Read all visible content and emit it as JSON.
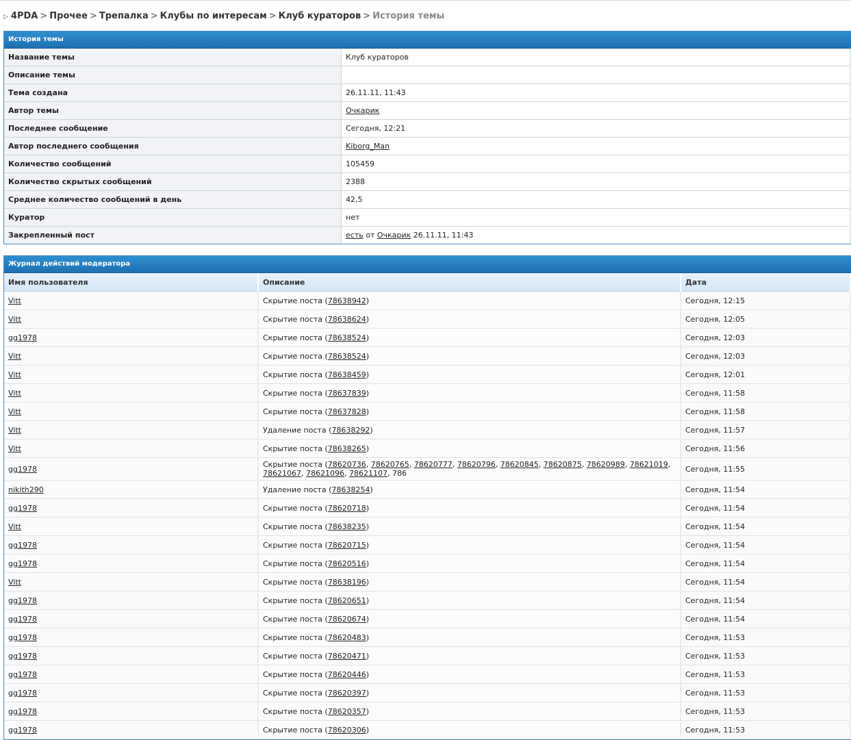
{
  "breadcrumb": {
    "items": [
      "4PDA",
      "Прочее",
      "Трепалка",
      "Клубы по интересам",
      "Клуб кураторов"
    ],
    "current": "История темы",
    "separator": ">",
    "arrow": "▷"
  },
  "history": {
    "title": "История темы",
    "rows": [
      {
        "label": "Название темы",
        "value": "Клуб кураторов"
      },
      {
        "label": "Описание темы",
        "value": ""
      },
      {
        "label": "Тема создана",
        "value": "26.11.11, 11:43"
      },
      {
        "label": "Автор темы",
        "value": "Очкарик",
        "link": true
      },
      {
        "label": "Последнее сообщение",
        "value": "Сегодня, 12:21"
      },
      {
        "label": "Автор последнего сообщения",
        "value": "Kiborg_Man",
        "link": true
      },
      {
        "label": "Количество сообщений",
        "value": "105459"
      },
      {
        "label": "Количество скрытых сообщений",
        "value": "2388"
      },
      {
        "label": "Среднее количество сообщений в день",
        "value": "42,5"
      },
      {
        "label": "Куратор",
        "value": "нет"
      }
    ],
    "pinned": {
      "label": "Закрепленный пост",
      "link1": "есть",
      "from": "от",
      "link2": "Очкарик",
      "date": "26.11.11, 11:43"
    }
  },
  "log": {
    "title": "Журнал действий модератора",
    "columns": [
      "Имя пользователя",
      "Описание",
      "Дата"
    ],
    "rows": [
      {
        "user": "Vitt",
        "action": "Скрытие поста",
        "posts": [
          "78638942"
        ],
        "date": "Сегодня, 12:15"
      },
      {
        "user": "Vitt",
        "action": "Скрытие поста",
        "posts": [
          "78638624"
        ],
        "date": "Сегодня, 12:05"
      },
      {
        "user": "gg1978",
        "action": "Скрытие поста",
        "posts": [
          "78638524"
        ],
        "date": "Сегодня, 12:03"
      },
      {
        "user": "Vitt",
        "action": "Скрытие поста",
        "posts": [
          "78638524"
        ],
        "date": "Сегодня, 12:03"
      },
      {
        "user": "Vitt",
        "action": "Скрытие поста",
        "posts": [
          "78638459"
        ],
        "date": "Сегодня, 12:01"
      },
      {
        "user": "Vitt",
        "action": "Скрытие поста",
        "posts": [
          "78637839"
        ],
        "date": "Сегодня, 11:58"
      },
      {
        "user": "Vitt",
        "action": "Скрытие поста",
        "posts": [
          "78637828"
        ],
        "date": "Сегодня, 11:58"
      },
      {
        "user": "Vitt",
        "action": "Удаление поста",
        "posts": [
          "78638292"
        ],
        "date": "Сегодня, 11:57"
      },
      {
        "user": "Vitt",
        "action": "Скрытие поста",
        "posts": [
          "78638265"
        ],
        "date": "Сегодня, 11:56"
      },
      {
        "user": "gg1978",
        "action": "Скрытие поста",
        "posts": [
          "78620736",
          "78620765",
          "78620777",
          "78620796",
          "78620845",
          "78620875",
          "78620989",
          "78621019",
          "78621067",
          "78621096",
          "78621107"
        ],
        "tail": "786",
        "date": "Сегодня, 11:55"
      },
      {
        "user": "nikith290",
        "action": "Удаление поста",
        "posts": [
          "78638254"
        ],
        "date": "Сегодня, 11:54"
      },
      {
        "user": "gg1978",
        "action": "Скрытие поста",
        "posts": [
          "78620718"
        ],
        "date": "Сегодня, 11:54"
      },
      {
        "user": "Vitt",
        "action": "Скрытие поста",
        "posts": [
          "78638235"
        ],
        "date": "Сегодня, 11:54"
      },
      {
        "user": "gg1978",
        "action": "Скрытие поста",
        "posts": [
          "78620715"
        ],
        "date": "Сегодня, 11:54"
      },
      {
        "user": "gg1978",
        "action": "Скрытие поста",
        "posts": [
          "78620516"
        ],
        "date": "Сегодня, 11:54"
      },
      {
        "user": "Vitt",
        "action": "Скрытие поста",
        "posts": [
          "78638196"
        ],
        "date": "Сегодня, 11:54"
      },
      {
        "user": "gg1978",
        "action": "Скрытие поста",
        "posts": [
          "78620651"
        ],
        "date": "Сегодня, 11:54"
      },
      {
        "user": "gg1978",
        "action": "Скрытие поста",
        "posts": [
          "78620674"
        ],
        "date": "Сегодня, 11:54"
      },
      {
        "user": "gg1978",
        "action": "Скрытие поста",
        "posts": [
          "78620483"
        ],
        "date": "Сегодня, 11:53"
      },
      {
        "user": "gg1978",
        "action": "Скрытие поста",
        "posts": [
          "78620471"
        ],
        "date": "Сегодня, 11:53"
      },
      {
        "user": "gg1978",
        "action": "Скрытие поста",
        "posts": [
          "78620446"
        ],
        "date": "Сегодня, 11:53"
      },
      {
        "user": "gg1978",
        "action": "Скрытие поста",
        "posts": [
          "78620397"
        ],
        "date": "Сегодня, 11:53"
      },
      {
        "user": "gg1978",
        "action": "Скрытие поста",
        "posts": [
          "78620357"
        ],
        "date": "Сегодня, 11:53"
      },
      {
        "user": "gg1978",
        "action": "Скрытие поста",
        "posts": [
          "78620306"
        ],
        "date": "Сегодня, 11:53"
      }
    ]
  }
}
